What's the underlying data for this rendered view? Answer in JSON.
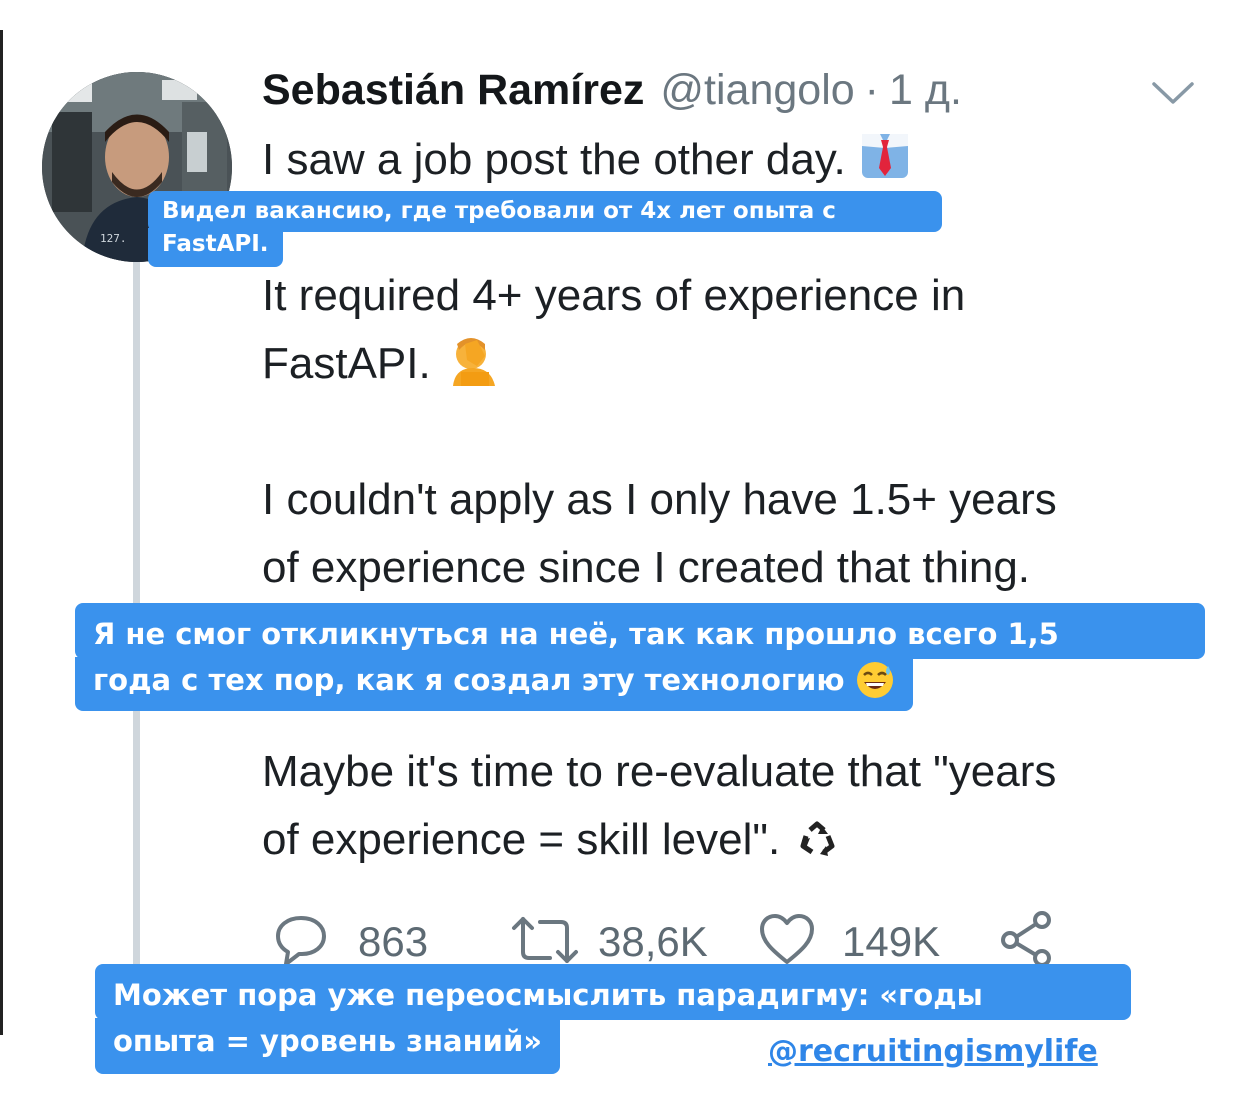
{
  "tweet": {
    "author_name": "Sebastián Ramírez",
    "handle": "@tiangolo",
    "separator": "·",
    "time": "1 д.",
    "lines": [
      "I saw a job post the other day.",
      "It required 4+ years of experience in",
      "FastAPI.",
      "I couldn't apply as I only have 1.5+ years",
      "of experience since I created that thing.",
      "Maybe it's time to re-evaluate that \"years",
      "of experience = skill level\"."
    ],
    "actions": {
      "replies": "863",
      "retweets": "38,6K",
      "likes": "149K"
    }
  },
  "captions": {
    "first": [
      "Видел вакансию, где требовали от 4х лет опыта с",
      "FastAPI."
    ],
    "second": [
      "Я не смог откликнуться на неё, так как прошло всего 1,5",
      "года с тех пор, как я создал эту технологию"
    ],
    "third": [
      "Может пора уже переосмыслить парадигму: «годы",
      "опыта = уровень знаний»"
    ]
  },
  "signature": "@recruitingismylife",
  "icons": {
    "avatar": "profile-photo",
    "menu": "chevron-down-icon",
    "reply": "comment-bubble-icon",
    "retweet": "retweet-icon",
    "like": "heart-icon",
    "share": "share-icon",
    "emoji_1": "necktie-emoji",
    "emoji_2": "facepalm-emoji",
    "emoji_3": "recycling-emoji",
    "emoji_4": "sweat-smile-emoji"
  },
  "colors": {
    "caption_bg": "#3a92ed",
    "signature": "#2f86e8",
    "muted_text": "#6b7780"
  }
}
